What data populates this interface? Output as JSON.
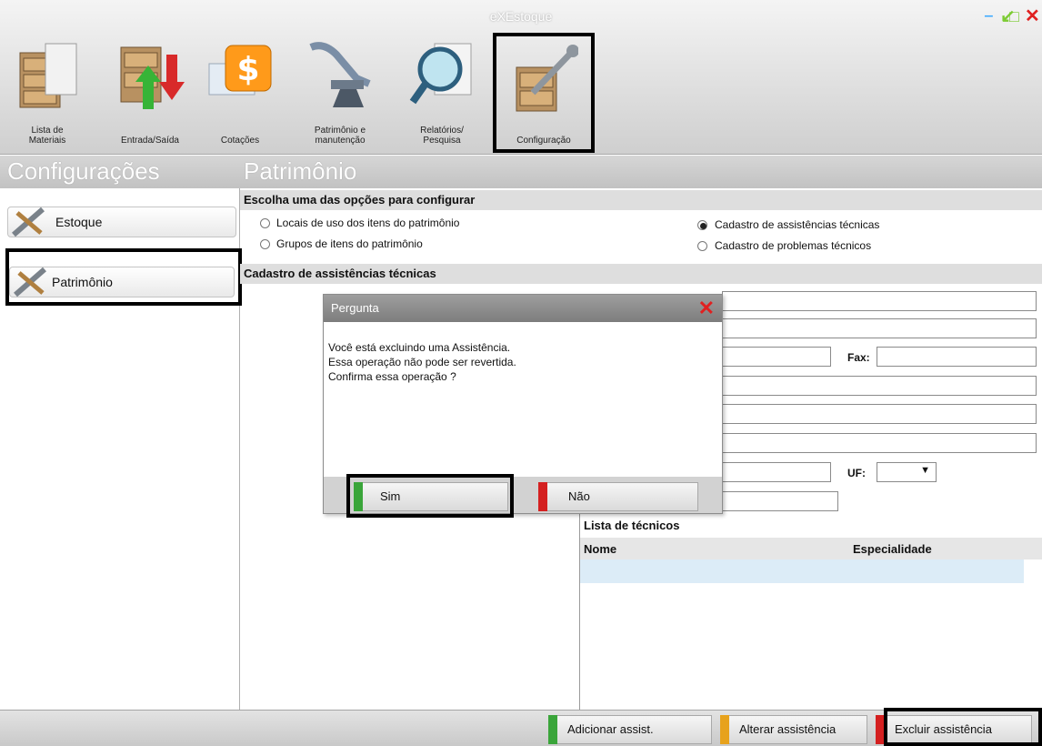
{
  "window": {
    "title": "eXEstoque",
    "controls": [
      "minimize-icon",
      "maximize-icon",
      "close-icon"
    ]
  },
  "toolbar": {
    "items": [
      {
        "label_line1": "Lista de",
        "label_line2": "Materiais",
        "icon": "file-cabinet-icon"
      },
      {
        "label_line1": "Entrada/Saída",
        "label_line2": "",
        "icon": "in-out-arrows-icon"
      },
      {
        "label_line1": "Cotações",
        "label_line2": "",
        "icon": "money-icon"
      },
      {
        "label_line1": "Patrimônio e",
        "label_line2": "manutenção",
        "icon": "dental-chair-icon"
      },
      {
        "label_line1": "Relatórios/",
        "label_line2": "Pesquisa",
        "icon": "magnifier-icon"
      },
      {
        "label_line1": "Configuração",
        "label_line2": "",
        "icon": "wrench-box-icon",
        "selected": true
      }
    ]
  },
  "sections": {
    "left_title": "Configurações",
    "right_title": "Patrimônio"
  },
  "sidebar": {
    "items": [
      {
        "label": "Estoque",
        "icon": "tools-icon"
      },
      {
        "label": "Patrimônio",
        "icon": "tools-icon",
        "selected": true
      }
    ]
  },
  "options": {
    "header": "Escolha uma das opções para configurar",
    "items": [
      {
        "label": "Locais de uso dos itens do patrimônio",
        "checked": false
      },
      {
        "label": "Grupos de itens do patrimônio",
        "checked": false
      },
      {
        "label": "Cadastro de assistências técnicas",
        "checked": true
      },
      {
        "label": "Cadastro de problemas técnicos",
        "checked": false
      }
    ]
  },
  "form": {
    "header": "Cadastro de assistências técnicas",
    "fax_label": "Fax:",
    "uf_label": "UF:"
  },
  "dialog": {
    "title": "Pergunta",
    "lines": [
      "Você está excluindo uma Assistência.",
      "Essa operação não pode ser revertida.",
      "Confirma essa operação ?"
    ],
    "yes_label": "Sim",
    "no_label": "Não"
  },
  "tecnicos": {
    "title": "Lista de técnicos",
    "columns": [
      "Nome",
      "Especialidade"
    ]
  },
  "bottom": {
    "add_label": "Adicionar assist.",
    "edit_label": "Alterar assistência",
    "delete_label": "Excluir assistência"
  },
  "colors": {
    "green": "#3aa53a",
    "orange": "#e7a21c",
    "red": "#d42020",
    "row_highlight": "#dcecf7"
  }
}
